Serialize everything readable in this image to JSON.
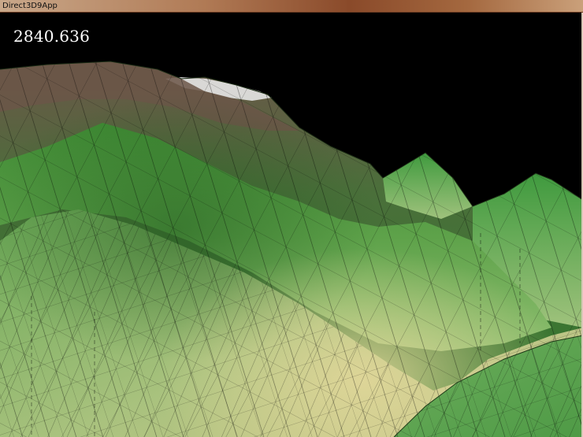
{
  "window": {
    "title": "Direct3D9App"
  },
  "viewport": {
    "frame_counter": "2840.636",
    "colors": {
      "background": "#000000",
      "grass_dark": "#2f7a2a",
      "grass_mid": "#4e9a3e",
      "grass_light": "#7fb86a",
      "sand": "#cbc489",
      "rock": "#6b5648",
      "snow": "#e8e8e8",
      "wireframe": "#000000"
    }
  }
}
